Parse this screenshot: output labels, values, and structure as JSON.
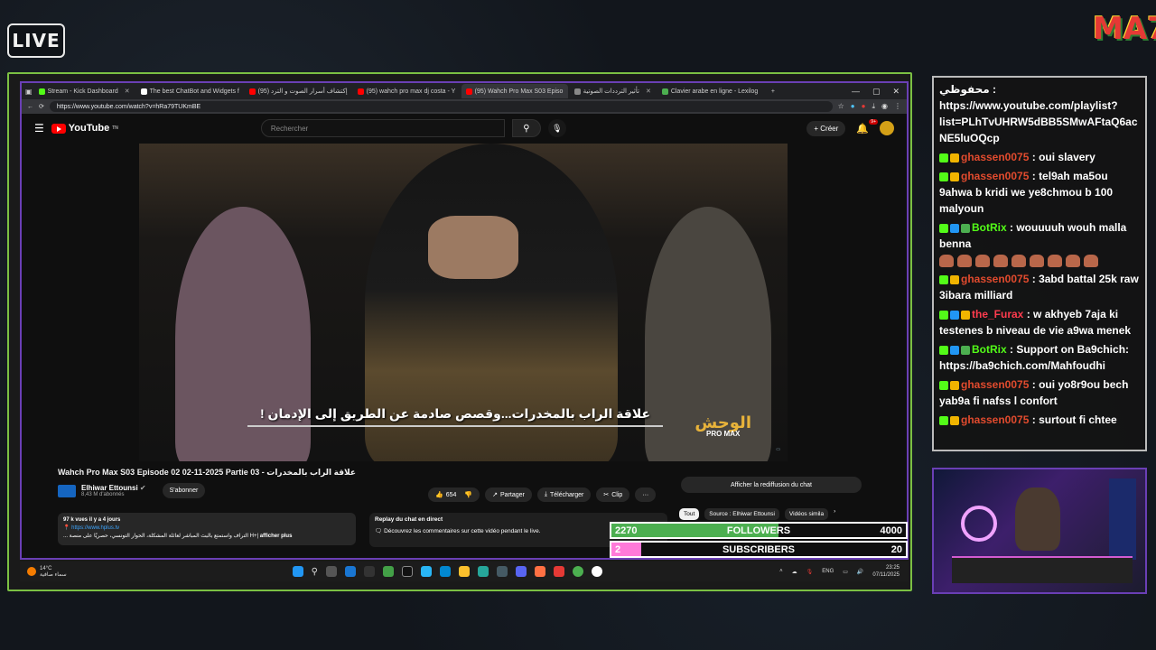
{
  "overlay": {
    "live_label": "LIVE",
    "brand_logo": "MA7"
  },
  "browser": {
    "tabs": [
      {
        "label": "Stream - Kick Dashboard",
        "color": "#53fc18"
      },
      {
        "label": "The best ChatBot and Widgets f",
        "color": "#ffffff"
      },
      {
        "label": "(95) إكتشاف أسرار الصوت و الترد",
        "color": "#ff0000"
      },
      {
        "label": "(95) wahch pro max dj costa - Y",
        "color": "#ff0000"
      },
      {
        "label": "(95) Wahch Pro Max S03 Episo",
        "color": "#ff0000"
      },
      {
        "label": "تأثير الترددات الصوتية",
        "color": "#888888"
      },
      {
        "label": "Clavier arabe en ligne - Lexilog",
        "color": "#4caf50"
      }
    ],
    "url": "https://www.youtube.com/watch?v=hRa79TUKmBE"
  },
  "youtube": {
    "logo_text": "YouTube",
    "logo_sup": "TN",
    "search_placeholder": "Rechercher",
    "create_label": "Créer",
    "notif_count": "9+",
    "video": {
      "subtitle": "علاقة الراب بالمخدرات...وقصص صادمة عن الطريق إلى الإدمان !",
      "show_logo": "الوحش",
      "show_logo_sub": "PRO MAX",
      "title": "Wahch Pro Max S03 Episode 02 02-11-2025 Partie 03 - علاقة الراب بالمخدرات",
      "channel_name": "Elhiwar Ettounsi",
      "channel_subs": "8,43 M d'abonnés",
      "subscribe_label": "S'abonner",
      "likes": "654",
      "share_label": "Partager",
      "download_label": "Télécharger",
      "clip_label": "Clip",
      "more_label": "···",
      "views_date": "97 k vues  il y a 4 jours",
      "desc_link": "https://www.hplus.tv",
      "desc_text": "... التراف واستمتع بالبث المباشر لعائلة المشكلة، الحوار التونسي، حصريًا على منصة H+|",
      "desc_more": "afficher plus",
      "replay_title": "Replay du chat en direct",
      "replay_text": "Découvrez les commentaires sur cette vidéo pendant le live.",
      "chat_replay_button": "Afficher la rediffusion du chat",
      "chips": [
        "Tout",
        "Source : Elhiwar Ettounsi",
        "Vidéos simila"
      ]
    }
  },
  "taskbar": {
    "weather_temp": "14°C",
    "weather_desc": "سماء صافية",
    "lang": "ENG",
    "time": "23:25",
    "date": "07/11/2025"
  },
  "counters": [
    {
      "current": "2270",
      "label": "FOLLOWERS",
      "goal": "4000",
      "fraction": 0.5675,
      "color": "#4caf50"
    },
    {
      "current": "2",
      "label": "SUBSCRIBERS",
      "goal": "20",
      "fraction": 0.1,
      "color": "#ff7ad9"
    }
  ],
  "chat": {
    "messages": [
      {
        "user": "محفوظي",
        "user_color": "#ffffff",
        "badges": [],
        "text": "https://www.youtube.com/playlist?list=PLhTvUHRW5dBB5SMwAFtaQ6acNE5luOQcp",
        "emotes": 0
      },
      {
        "user": "ghassen0075",
        "user_color": "#e24b2e",
        "badges": [
          "#53fc18",
          "#f0b400"
        ],
        "text": "oui slavery",
        "emotes": 0
      },
      {
        "user": "ghassen0075",
        "user_color": "#e24b2e",
        "badges": [
          "#53fc18",
          "#f0b400"
        ],
        "text": "tel9ah ma5ou 9ahwa b kridi we ye8chmou b 100 malyoun",
        "emotes": 0
      },
      {
        "user": "BotRix",
        "user_color": "#53fc18",
        "badges": [
          "#53fc18",
          "#2196f3",
          "#4caf50"
        ],
        "text": "wouuuuh wouh malla benna",
        "emotes": 9
      },
      {
        "user": "ghassen0075",
        "user_color": "#e24b2e",
        "badges": [
          "#53fc18",
          "#f0b400"
        ],
        "text": "3abd battal 25k raw 3ibara milliard",
        "emotes": 0
      },
      {
        "user": "the_Furax",
        "user_color": "#ff3b4e",
        "badges": [
          "#53fc18",
          "#2196f3",
          "#f0b400"
        ],
        "text": "w akhyeb 7aja ki testenes b niveau de vie a9wa menek",
        "emotes": 0
      },
      {
        "user": "BotRix",
        "user_color": "#53fc18",
        "badges": [
          "#53fc18",
          "#2196f3",
          "#4caf50"
        ],
        "text": "Support on Ba9chich: https://ba9chich.com/Mahfoudhi",
        "emotes": 0
      },
      {
        "user": "ghassen0075",
        "user_color": "#e24b2e",
        "badges": [
          "#53fc18",
          "#f0b400"
        ],
        "text": "oui yo8r9ou bech yab9a fi nafss l confort",
        "emotes": 0
      },
      {
        "user": "ghassen0075",
        "user_color": "#e24b2e",
        "badges": [
          "#53fc18",
          "#f0b400"
        ],
        "text": "surtout fi chtee",
        "emotes": 0
      }
    ]
  }
}
